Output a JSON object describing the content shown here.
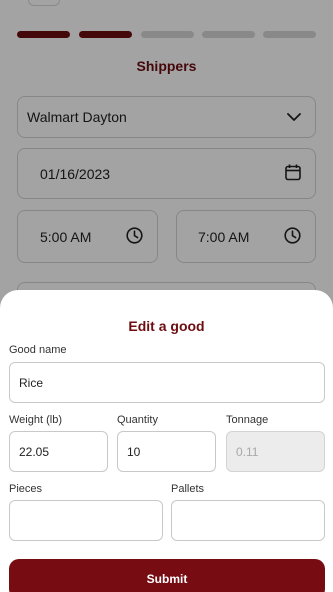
{
  "background": {
    "steps": [
      {
        "state": "done"
      },
      {
        "state": "done"
      },
      {
        "state": "todo"
      },
      {
        "state": "todo"
      },
      {
        "state": "todo"
      }
    ],
    "section_title": "Shippers",
    "shipper_select": {
      "value": "Walmart Dayton",
      "icon": "chevron-down-icon"
    },
    "date_field": {
      "value": "01/16/2023",
      "icon": "calendar-icon"
    },
    "start_time": {
      "value": "5:00 AM",
      "icon": "clock-icon"
    },
    "end_time": {
      "value": "7:00 AM",
      "icon": "clock-icon"
    }
  },
  "sheet": {
    "title": "Edit a good",
    "good_name": {
      "label": "Good name",
      "value": "Rice"
    },
    "weight": {
      "label": "Weight (lb)",
      "value": "22.05"
    },
    "quantity": {
      "label": "Quantity",
      "value": "10"
    },
    "tonnage": {
      "label": "Tonnage",
      "value": "0.11"
    },
    "pieces": {
      "label": "Pieces",
      "value": ""
    },
    "pallets": {
      "label": "Pallets",
      "value": ""
    },
    "submit_label": "Submit"
  },
  "colors": {
    "accent": "#6d0d10",
    "submit": "#770d12",
    "step_inactive": "#d7d7d7",
    "disabled_field": "#ececec"
  }
}
